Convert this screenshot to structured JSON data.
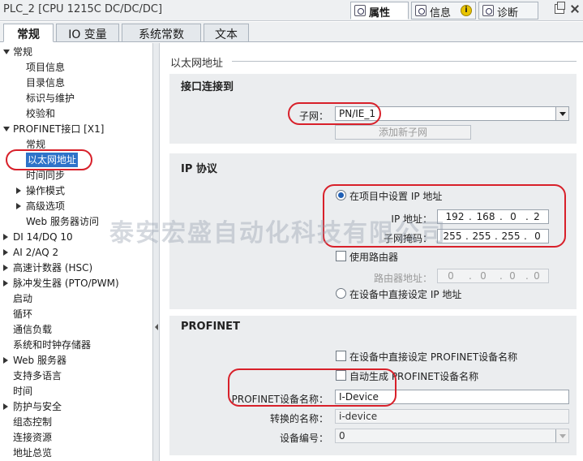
{
  "window": {
    "title": "PLC_2 [CPU 1215C DC/DC/DC]",
    "panel_tabs": [
      {
        "label": "属性",
        "icon": "properties-icon",
        "active": true
      },
      {
        "label": "信息",
        "icon": "info-list-icon",
        "active": false
      },
      {
        "label": "诊断",
        "icon": "diagnostics-icon",
        "active": false
      }
    ],
    "info_badge": "i"
  },
  "sub_tabs": [
    {
      "label": "常规",
      "active": true
    },
    {
      "label": "IO 变量",
      "active": false
    },
    {
      "label": "系统常数",
      "active": false
    },
    {
      "label": "文本",
      "active": false
    }
  ],
  "nav": {
    "items": [
      {
        "label": "常规",
        "arrow": "down",
        "indent": 0
      },
      {
        "label": "项目信息",
        "arrow": "",
        "indent": 2
      },
      {
        "label": "目录信息",
        "arrow": "",
        "indent": 2
      },
      {
        "label": "标识与维护",
        "arrow": "",
        "indent": 2
      },
      {
        "label": "校验和",
        "arrow": "",
        "indent": 2
      },
      {
        "label": "PROFINET接口 [X1]",
        "arrow": "down",
        "indent": 0
      },
      {
        "label": "常规",
        "arrow": "",
        "indent": 2
      },
      {
        "label": "以太网地址",
        "arrow": "",
        "indent": 2,
        "selected": true
      },
      {
        "label": "时间同步",
        "arrow": "",
        "indent": 2
      },
      {
        "label": "操作模式",
        "arrow": "right",
        "indent": 1
      },
      {
        "label": "高级选项",
        "arrow": "right",
        "indent": 1
      },
      {
        "label": "Web 服务器访问",
        "arrow": "",
        "indent": 2
      },
      {
        "label": "DI 14/DQ 10",
        "arrow": "right",
        "indent": 0
      },
      {
        "label": "AI 2/AQ 2",
        "arrow": "right",
        "indent": 0
      },
      {
        "label": "高速计数器 (HSC)",
        "arrow": "right",
        "indent": 0
      },
      {
        "label": "脉冲发生器 (PTO/PWM)",
        "arrow": "right",
        "indent": 0
      },
      {
        "label": "启动",
        "arrow": "",
        "indent": 0
      },
      {
        "label": "循环",
        "arrow": "",
        "indent": 0
      },
      {
        "label": "通信负载",
        "arrow": "",
        "indent": 0
      },
      {
        "label": "系统和时钟存储器",
        "arrow": "",
        "indent": 0
      },
      {
        "label": "Web 服务器",
        "arrow": "right",
        "indent": 0
      },
      {
        "label": "支持多语言",
        "arrow": "",
        "indent": 0
      },
      {
        "label": "时间",
        "arrow": "",
        "indent": 0
      },
      {
        "label": "防护与安全",
        "arrow": "right",
        "indent": 0
      },
      {
        "label": "组态控制",
        "arrow": "",
        "indent": 0
      },
      {
        "label": "连接资源",
        "arrow": "",
        "indent": 0
      },
      {
        "label": "地址总览",
        "arrow": "",
        "indent": 0
      }
    ]
  },
  "content": {
    "section_title": "以太网地址",
    "interface": {
      "title": "接口连接到",
      "subnet_label": "子网：",
      "subnet_value": "PN/IE_1",
      "add_subnet_button": "添加新子网"
    },
    "ip": {
      "title": "IP 协议",
      "set_in_project_label": "在项目中设置 IP 地址",
      "set_in_project_selected": true,
      "ip_label": "IP 地址：",
      "ip_value": [
        "192",
        "168",
        "0",
        "2"
      ],
      "mask_label": "子网掩码：",
      "mask_value": [
        "255",
        "255",
        "255",
        "0"
      ],
      "use_router_label": "使用路由器",
      "use_router_checked": false,
      "router_label": "路由器地址：",
      "router_value": [
        "0",
        "0",
        "0",
        "0"
      ],
      "set_on_device_label": "在设备中直接设定 IP 地址",
      "set_on_device_selected": false
    },
    "profinet": {
      "title": "PROFINET",
      "set_name_on_device_label": "在设备中直接设定 PROFINET设备名称",
      "set_name_on_device_checked": false,
      "auto_name_label": "自动生成 PROFINET设备名称",
      "auto_name_checked": false,
      "device_name_label": "PROFINET设备名称：",
      "device_name_value": "I-Device",
      "converted_name_label": "转换的名称：",
      "converted_name_value": "i-device",
      "device_number_label": "设备编号：",
      "device_number_value": "0"
    }
  },
  "watermark": "泰安宏盛自动化科技有限公司",
  "colors": {
    "selection": "#2f73c9",
    "highlight_ring": "#d8202a",
    "group_background": "#ebedef"
  }
}
